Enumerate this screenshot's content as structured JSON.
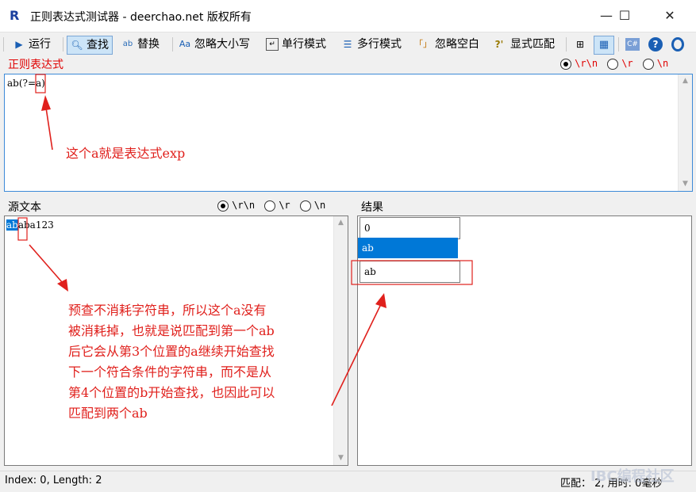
{
  "window": {
    "app_icon": "R",
    "title": "正则表达式测试器 - deerchao.net 版权所有",
    "minimize": "—",
    "maximize": "☐",
    "close": "✕"
  },
  "toolbar": {
    "run": "运行",
    "find": "查找",
    "replace": "替换",
    "ignore_case": "忽略大小写",
    "single_line": "单行模式",
    "multi_line": "多行模式",
    "ignore_space": "忽略空白",
    "explicit_capture": "显式匹配",
    "ignore_space_icon_text": "「」",
    "explicit_icon_text": "?'",
    "csharp_icon_text": "C#",
    "help_icon_text": "?",
    "icons": {
      "run": "play-icon",
      "find": "magnifier-icon",
      "replace": "replace-icon",
      "ignore_case": "case-icon",
      "single_line": "single-line-icon",
      "multi_line": "multi-line-icon",
      "tree": "tree-icon",
      "table": "table-icon",
      "csharp": "csharp-icon",
      "help": "help-icon",
      "about": "circle-icon"
    }
  },
  "regex": {
    "label": "正则表达式",
    "value": "ab(?=a)",
    "newline_options": [
      "\\r\\n",
      "\\r",
      "\\n"
    ],
    "newline_selected": 0,
    "annotation": "这个a就是表达式exp"
  },
  "source": {
    "label": "源文本",
    "match_text": "ab",
    "rest_text": "aba123",
    "newline_options": [
      "\\r\\n",
      "\\r",
      "\\n"
    ],
    "newline_selected": 0,
    "annotation_lines": [
      "预查不消耗字符串，所以这个a没有",
      "被消耗掉，也就是说匹配到第一个ab",
      "后它会从第3个位置的a继续开始查找",
      "下一个符合条件的字符串，而不是从",
      "第4个位置的b开始查找，也因此可以",
      "匹配到两个ab"
    ]
  },
  "result": {
    "label": "结果",
    "items": [
      "0",
      "ab",
      "ab"
    ],
    "selected": 1
  },
  "status": {
    "left": "Index: 0, Length: 2",
    "right": "匹配：  2, 用时: 0毫秒",
    "watermark": "IBC编程社区"
  },
  "colors": {
    "accent": "#0078d7",
    "annotation": "#e0201c",
    "selection": "#0078d7"
  }
}
